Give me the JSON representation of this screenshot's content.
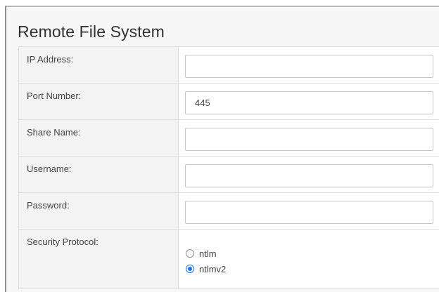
{
  "section": {
    "title": "Remote File System"
  },
  "fields": [
    {
      "label": "IP Address:",
      "value": ""
    },
    {
      "label": "Port Number:",
      "value": "445"
    },
    {
      "label": "Share Name:",
      "value": ""
    },
    {
      "label": "Username:",
      "value": ""
    },
    {
      "label": "Password:",
      "value": ""
    }
  ],
  "security_protocol": {
    "label": "Security Protocol:",
    "options": [
      {
        "label": "ntlm",
        "selected": false
      },
      {
        "label": "ntlmv2",
        "selected": true
      }
    ]
  },
  "colors": {
    "selected_radio": "#1a73e8",
    "cell_border": "#dddddd"
  }
}
